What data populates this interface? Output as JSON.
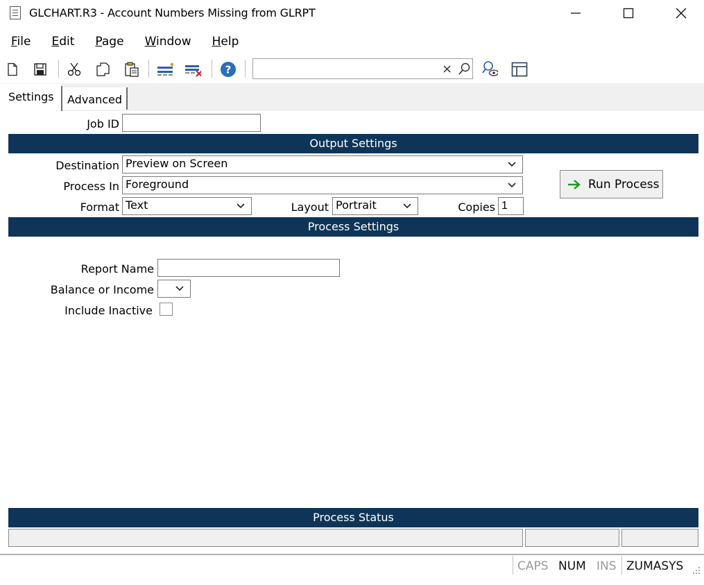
{
  "window": {
    "title": "GLCHART.R3 - Account Numbers Missing from GLRPT",
    "controls": {
      "minimize": "—",
      "maximize": "☐",
      "close": "✕"
    }
  },
  "menu": [
    {
      "label": "File",
      "accel": "F",
      "rest": "ile"
    },
    {
      "label": "Edit",
      "accel": "E",
      "rest": "dit"
    },
    {
      "label": "Page",
      "accel": "P",
      "rest": "age"
    },
    {
      "label": "Window",
      "accel": "W",
      "rest": "indow"
    },
    {
      "label": "Help",
      "accel": "H",
      "rest": "elp"
    }
  ],
  "toolbar": {
    "icons": [
      "new-doc-icon",
      "save-icon",
      "cut-icon",
      "copy-icon",
      "paste-icon",
      "insert-row-icon",
      "delete-row-icon",
      "help-icon",
      "search-clear-icon",
      "search-icon",
      "lookup-icon",
      "layout-icon"
    ],
    "search": {
      "value": "",
      "clear_glyph": "×"
    }
  },
  "tabs": [
    {
      "label": "Settings",
      "active": true
    },
    {
      "label": "Advanced",
      "active": false
    }
  ],
  "form": {
    "job_id": {
      "label": "Job ID",
      "value": ""
    },
    "output_section": "Output Settings",
    "destination": {
      "label": "Destination",
      "value": "Preview on Screen"
    },
    "process_in": {
      "label": "Process In",
      "value": "Foreground"
    },
    "format": {
      "label": "Format",
      "value": "Text"
    },
    "layout": {
      "label": "Layout",
      "value": "Portrait"
    },
    "copies": {
      "label": "Copies",
      "value": "1"
    },
    "run_button": "Run Process",
    "process_section": "Process Settings",
    "report_name": {
      "label": "Report Name",
      "value": ""
    },
    "balance_income": {
      "label": "Balance or Income",
      "value": ""
    },
    "include_inactive": {
      "label": "Include Inactive",
      "checked": false
    },
    "status_section": "Process Status"
  },
  "statusbar": {
    "caps": "CAPS",
    "num": "NUM",
    "ins": "INS",
    "user": "ZUMASYS"
  },
  "colors": {
    "section_bar": "#0e3557",
    "run_arrow": "#1a9a1a",
    "help_icon": "#2c6fb5",
    "delete_x": "#d02020",
    "toolbar_blue": "#2c5fa5"
  }
}
